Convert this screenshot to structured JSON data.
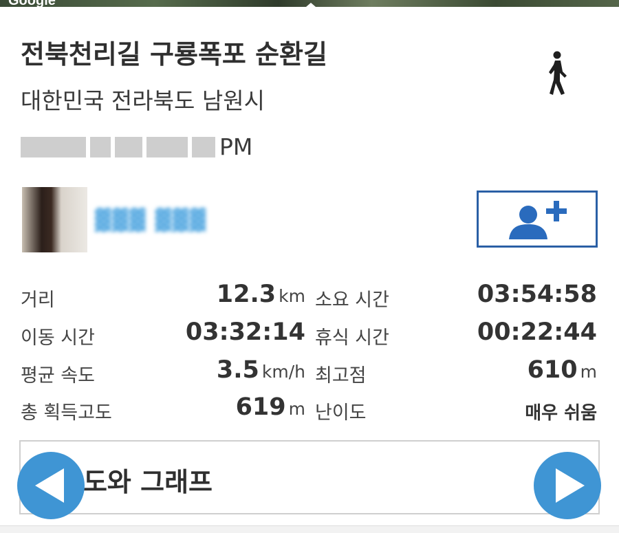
{
  "map": {
    "watermark": "Google"
  },
  "route": {
    "title": "전북천리길 구룡폭포 순환길",
    "location": "대한민국 전라북도 남원시",
    "datetime_suffix": "PM",
    "activity_icon": "walking-person-icon"
  },
  "user": {
    "avatar_icon": "avatar",
    "add_friend_icon": "add-person-icon"
  },
  "stats": {
    "distance": {
      "label": "거리",
      "value": "12.3",
      "unit": "km"
    },
    "duration": {
      "label": "소요 시간",
      "value": "03:54:58"
    },
    "moving_time": {
      "label": "이동 시간",
      "value": "03:32:14"
    },
    "rest_time": {
      "label": "휴식 시간",
      "value": "00:22:44"
    },
    "avg_speed": {
      "label": "평균 속도",
      "value": "3.5",
      "unit": "km/h"
    },
    "max_elevation": {
      "label": "최고점",
      "value": "610",
      "unit": "m"
    },
    "total_ascent": {
      "label": "총 획득고도",
      "value": "619",
      "unit": "m"
    },
    "difficulty": {
      "label": "난이도",
      "value": "매우 쉬움"
    }
  },
  "graph_section": {
    "label": "지도와 그래프"
  },
  "nav": {
    "prev_icon": "chevron-left-icon",
    "next_icon": "chevron-right-icon"
  },
  "colors": {
    "accent_blue": "#3f95d4",
    "button_border": "#2a5fa5"
  }
}
